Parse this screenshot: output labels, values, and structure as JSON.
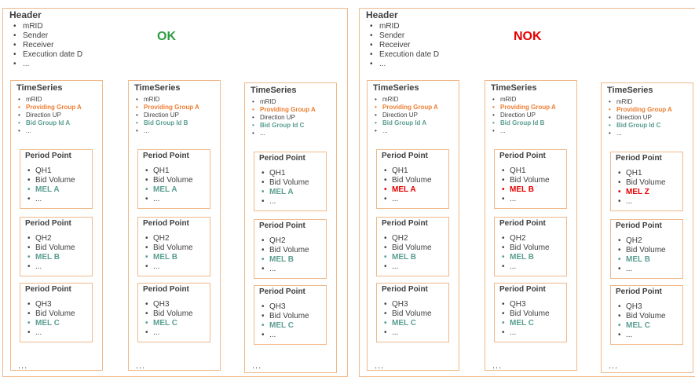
{
  "colors": {
    "border": "#f0b98a",
    "ok": "#2e9d44",
    "nok": "#e60000",
    "providing_group": "#ed7d31",
    "bid_group": "#5b9e91",
    "mel_ok": "#5b9e91",
    "mel_error": "#e60000"
  },
  "panels": [
    {
      "header_title": "Header",
      "header_items": [
        "mRID",
        "Sender",
        "Receiver",
        "Execution date D",
        "..."
      ],
      "status": "OK",
      "status_color": "#2e9d44",
      "timeseries": [
        {
          "title": "TimeSeries",
          "items": [
            {
              "text": "mRID",
              "style": "normal"
            },
            {
              "text": "Providing Group A",
              "style": "orange"
            },
            {
              "text": "Direction UP",
              "style": "normal"
            },
            {
              "text": "Bid Group Id A",
              "style": "teal"
            },
            {
              "text": "...",
              "style": "normal"
            }
          ],
          "period_points": [
            {
              "title": "Period Point",
              "items": [
                {
                  "text": "QH1",
                  "style": "normal"
                },
                {
                  "text": "Bid Volume",
                  "style": "normal"
                },
                {
                  "text": "MEL A",
                  "style": "teal"
                },
                {
                  "text": "...",
                  "style": "normal"
                }
              ]
            },
            {
              "title": "Period Point",
              "items": [
                {
                  "text": "QH2",
                  "style": "normal"
                },
                {
                  "text": "Bid Volume",
                  "style": "normal"
                },
                {
                  "text": "MEL B",
                  "style": "teal"
                },
                {
                  "text": "...",
                  "style": "normal"
                }
              ]
            },
            {
              "title": "Period Point",
              "items": [
                {
                  "text": "QH3",
                  "style": "normal"
                },
                {
                  "text": "Bid Volume",
                  "style": "normal"
                },
                {
                  "text": "MEL C",
                  "style": "teal"
                },
                {
                  "text": "...",
                  "style": "normal"
                }
              ]
            }
          ],
          "more": "..."
        },
        {
          "title": "TimeSeries",
          "items": [
            {
              "text": "mRID",
              "style": "normal"
            },
            {
              "text": "Providing Group A",
              "style": "orange"
            },
            {
              "text": "Direction UP",
              "style": "normal"
            },
            {
              "text": "Bid Group Id B",
              "style": "teal"
            },
            {
              "text": "...",
              "style": "normal"
            }
          ],
          "period_points": [
            {
              "title": "Period Point",
              "items": [
                {
                  "text": "QH1",
                  "style": "normal"
                },
                {
                  "text": "Bid Volume",
                  "style": "normal"
                },
                {
                  "text": "MEL A",
                  "style": "teal"
                },
                {
                  "text": "...",
                  "style": "normal"
                }
              ]
            },
            {
              "title": "Period Point",
              "items": [
                {
                  "text": "QH2",
                  "style": "normal"
                },
                {
                  "text": "Bid Volume",
                  "style": "normal"
                },
                {
                  "text": "MEL B",
                  "style": "teal"
                },
                {
                  "text": "...",
                  "style": "normal"
                }
              ]
            },
            {
              "title": "Period Point",
              "items": [
                {
                  "text": "QH3",
                  "style": "normal"
                },
                {
                  "text": "Bid Volume",
                  "style": "normal"
                },
                {
                  "text": "MEL C",
                  "style": "teal"
                },
                {
                  "text": "...",
                  "style": "normal"
                }
              ]
            }
          ],
          "more": "..."
        },
        {
          "title": "TimeSeries",
          "items": [
            {
              "text": "mRID",
              "style": "normal"
            },
            {
              "text": "Providing Group A",
              "style": "orange"
            },
            {
              "text": "Direction UP",
              "style": "normal"
            },
            {
              "text": "Bid Group Id C",
              "style": "teal"
            },
            {
              "text": "...",
              "style": "normal"
            }
          ],
          "period_points": [
            {
              "title": "Period Point",
              "items": [
                {
                  "text": "QH1",
                  "style": "normal"
                },
                {
                  "text": "Bid Volume",
                  "style": "normal"
                },
                {
                  "text": "MEL A",
                  "style": "teal"
                },
                {
                  "text": "...",
                  "style": "normal"
                }
              ]
            },
            {
              "title": "Period Point",
              "items": [
                {
                  "text": "QH2",
                  "style": "normal"
                },
                {
                  "text": "Bid Volume",
                  "style": "normal"
                },
                {
                  "text": "MEL B",
                  "style": "teal"
                },
                {
                  "text": "...",
                  "style": "normal"
                }
              ]
            },
            {
              "title": "Period Point",
              "items": [
                {
                  "text": "QH3",
                  "style": "normal"
                },
                {
                  "text": "Bid Volume",
                  "style": "normal"
                },
                {
                  "text": "MEL C",
                  "style": "teal"
                },
                {
                  "text": "...",
                  "style": "normal"
                }
              ]
            }
          ],
          "more": "..."
        }
      ]
    },
    {
      "header_title": "Header",
      "header_items": [
        "mRID",
        "Sender",
        "Receiver",
        "Execution date D",
        "..."
      ],
      "status": "NOK",
      "status_color": "#e60000",
      "timeseries": [
        {
          "title": "TimeSeries",
          "items": [
            {
              "text": "mRID",
              "style": "normal"
            },
            {
              "text": "Providing Group A",
              "style": "orange"
            },
            {
              "text": "Direction UP",
              "style": "normal"
            },
            {
              "text": "Bid Group Id A",
              "style": "teal"
            },
            {
              "text": "...",
              "style": "normal"
            }
          ],
          "period_points": [
            {
              "title": "Period Point",
              "items": [
                {
                  "text": "QH1",
                  "style": "normal"
                },
                {
                  "text": "Bid Volume",
                  "style": "normal"
                },
                {
                  "text": "MEL A",
                  "style": "red"
                },
                {
                  "text": "...",
                  "style": "normal"
                }
              ]
            },
            {
              "title": "Period Point",
              "items": [
                {
                  "text": "QH2",
                  "style": "normal"
                },
                {
                  "text": "Bid Volume",
                  "style": "normal"
                },
                {
                  "text": "MEL B",
                  "style": "teal"
                },
                {
                  "text": "...",
                  "style": "normal"
                }
              ]
            },
            {
              "title": "Period Point",
              "items": [
                {
                  "text": "QH3",
                  "style": "normal"
                },
                {
                  "text": "Bid Volume",
                  "style": "normal"
                },
                {
                  "text": "MEL C",
                  "style": "teal"
                },
                {
                  "text": "...",
                  "style": "normal"
                }
              ]
            }
          ],
          "more": "..."
        },
        {
          "title": "TimeSeries",
          "items": [
            {
              "text": "mRID",
              "style": "normal"
            },
            {
              "text": "Providing Group A",
              "style": "orange"
            },
            {
              "text": "Direction UP",
              "style": "normal"
            },
            {
              "text": "Bid Group Id B",
              "style": "teal"
            },
            {
              "text": "...",
              "style": "normal"
            }
          ],
          "period_points": [
            {
              "title": "Period Point",
              "items": [
                {
                  "text": "QH1",
                  "style": "normal"
                },
                {
                  "text": "Bid Volume",
                  "style": "normal"
                },
                {
                  "text": "MEL B",
                  "style": "red"
                },
                {
                  "text": "...",
                  "style": "normal"
                }
              ]
            },
            {
              "title": "Period Point",
              "items": [
                {
                  "text": "QH2",
                  "style": "normal"
                },
                {
                  "text": "Bid Volume",
                  "style": "normal"
                },
                {
                  "text": "MEL B",
                  "style": "teal"
                },
                {
                  "text": "...",
                  "style": "normal"
                }
              ]
            },
            {
              "title": "Period Point",
              "items": [
                {
                  "text": "QH3",
                  "style": "normal"
                },
                {
                  "text": "Bid Volume",
                  "style": "normal"
                },
                {
                  "text": "MEL C",
                  "style": "teal"
                },
                {
                  "text": "...",
                  "style": "normal"
                }
              ]
            }
          ],
          "more": "..."
        },
        {
          "title": "TimeSeries",
          "items": [
            {
              "text": "mRID",
              "style": "normal"
            },
            {
              "text": "Providing Group A",
              "style": "orange"
            },
            {
              "text": "Direction UP",
              "style": "normal"
            },
            {
              "text": "Bid Group Id C",
              "style": "teal"
            },
            {
              "text": "...",
              "style": "normal"
            }
          ],
          "period_points": [
            {
              "title": "Period Point",
              "items": [
                {
                  "text": "QH1",
                  "style": "normal"
                },
                {
                  "text": "Bid Volume",
                  "style": "normal"
                },
                {
                  "text": "MEL Z",
                  "style": "red"
                },
                {
                  "text": "...",
                  "style": "normal"
                }
              ]
            },
            {
              "title": "Period Point",
              "items": [
                {
                  "text": "QH2",
                  "style": "normal"
                },
                {
                  "text": "Bid Volume",
                  "style": "normal"
                },
                {
                  "text": "MEL B",
                  "style": "teal"
                },
                {
                  "text": "...",
                  "style": "normal"
                }
              ]
            },
            {
              "title": "Period Point",
              "items": [
                {
                  "text": "QH3",
                  "style": "normal"
                },
                {
                  "text": "Bid Volume",
                  "style": "normal"
                },
                {
                  "text": "MEL C",
                  "style": "teal"
                },
                {
                  "text": "...",
                  "style": "normal"
                }
              ]
            }
          ],
          "more": "..."
        }
      ]
    }
  ]
}
